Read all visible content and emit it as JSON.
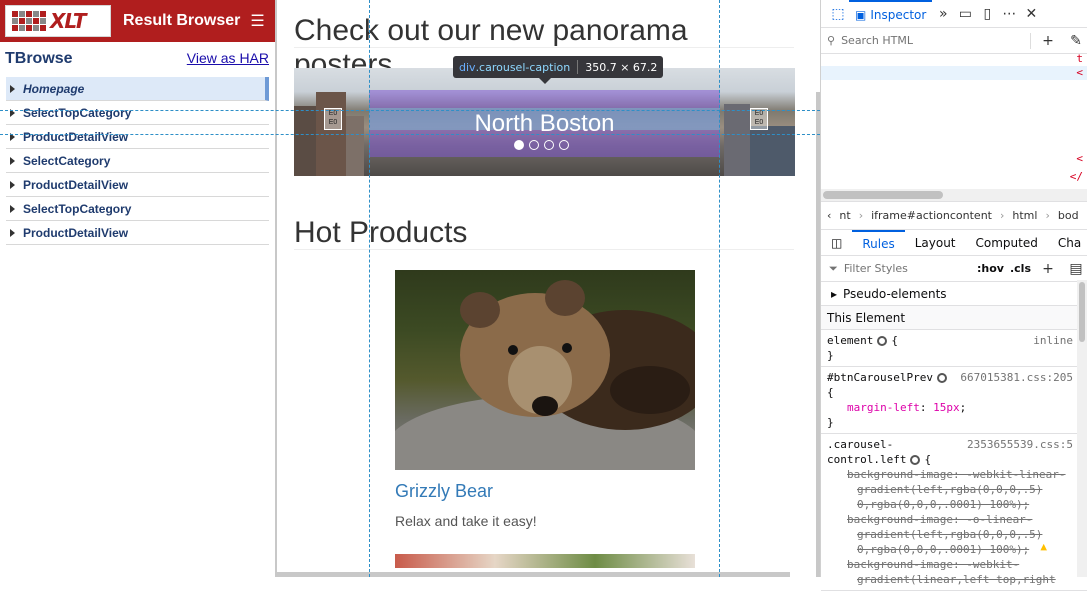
{
  "left_panel": {
    "logo_text": "XLT",
    "title": "Result Browser",
    "menu_icon": "hamburger-icon",
    "tree_title": "TBrowse",
    "har_link": "View as HAR",
    "actions": [
      {
        "label": "Homepage",
        "selected": true
      },
      {
        "label": "SelectTopCategory",
        "selected": false
      },
      {
        "label": "ProductDetailView",
        "selected": false
      },
      {
        "label": "SelectCategory",
        "selected": false
      },
      {
        "label": "ProductDetailView",
        "selected": false
      },
      {
        "label": "SelectTopCategory",
        "selected": false
      },
      {
        "label": "ProductDetailView",
        "selected": false
      }
    ],
    "accent_color": "#b01e1e"
  },
  "main": {
    "panorama_heading": "Check out our new panorama posters",
    "carousel": {
      "caption": "North Boston",
      "prev_label": "E0 E0",
      "next_label": "E0 E0",
      "slide_count": 4,
      "active_slide": 1
    },
    "tooltip": {
      "tag": "div",
      "class": ".carousel-caption",
      "size": "350.7 × 67.2"
    },
    "hot_heading": "Hot Products",
    "product": {
      "name": "Grizzly Bear",
      "description": "Relax and take it easy!"
    },
    "link_color": "#337ab7"
  },
  "devtools": {
    "inspector_tab": "Inspector",
    "search_placeholder": "Search HTML",
    "markup_fragments": [
      "t",
      "<",
      "<",
      "</"
    ],
    "breadcrumbs": [
      "nt",
      "iframe#actioncontent",
      "html",
      "bod"
    ],
    "tabs": [
      "Rules",
      "Layout",
      "Computed",
      "Cha"
    ],
    "active_tab": "Rules",
    "filter_placeholder": "Filter Styles",
    "hov_label": ":hov",
    "cls_label": ".cls",
    "pseudo_elements": "Pseudo-elements",
    "this_element": "This Element",
    "rules": {
      "element": {
        "selector": "element",
        "source": "inline"
      },
      "btn": {
        "selector": "#btnCarouselPrev",
        "source": "667015381.css:205",
        "prop": "margin-left",
        "value": "15px"
      },
      "carousel": {
        "selector_1": ".carousel-",
        "selector_2": "control.left",
        "source": "2353655539.css:5",
        "lines": [
          "background-image: -webkit-linear-",
          "gradient(left,rgba(0,0,0,.5)",
          "0,rgba(0,0,0,.0001) 100%);",
          "background-image: -o-linear-",
          "gradient(left,rgba(0,0,0,.5)",
          "0,rgba(0,0,0,.0001) 100%);",
          "background-image: -webkit-",
          "gradient(linear,left top,right"
        ]
      }
    },
    "accent_color": "#0060df"
  }
}
